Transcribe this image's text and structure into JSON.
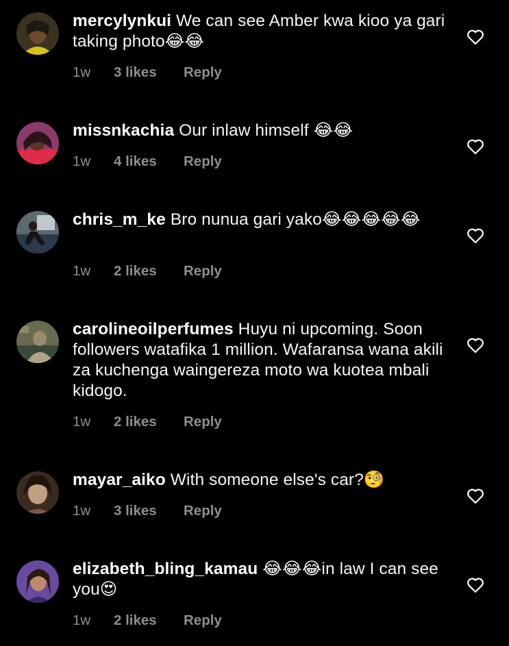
{
  "comments": [
    {
      "username": "mercylynkui",
      "text": "We can see Amber kwa kioo ya gari taking photo😂😂",
      "time": "1w",
      "likes": "3 likes",
      "reply": "Reply",
      "avatar_colors": [
        "#3a3320",
        "#d4c21a",
        "#5a4026"
      ]
    },
    {
      "username": "missnkachia",
      "text": "Our inlaw himself 😂😂",
      "time": "1w",
      "likes": "4 likes",
      "reply": "Reply",
      "avatar_colors": [
        "#8a3b6a",
        "#e02a4a",
        "#4a2030"
      ]
    },
    {
      "username": "chris_m_ke",
      "text": "Bro nunua gari yako😂😂😂😂😂",
      "time": "1w",
      "likes": "2 likes",
      "reply": "Reply",
      "avatar_colors": [
        "#5a6a70",
        "#2a3a4a",
        "#c0c8cc"
      ]
    },
    {
      "username": "carolineoilperfumes",
      "text": "Huyu ni upcoming. Soon followers watafika 1 million. Wafaransa wana akili za kuchenga waingereza moto wa kuotea mbali kidogo.",
      "time": "1w",
      "likes": "2 likes",
      "reply": "Reply",
      "avatar_colors": [
        "#6a6a50",
        "#9a8a70",
        "#3a4a3a"
      ]
    },
    {
      "username": "mayar_aiko",
      "text": "With someone else's car?🧐",
      "time": "1w",
      "likes": "3 likes",
      "reply": "Reply",
      "avatar_colors": [
        "#3a2a20",
        "#7a5a40",
        "#c0a080"
      ]
    },
    {
      "username": "elizabeth_bling_kamau",
      "text": "😂😂😂in law I can see you😍",
      "time": "1w",
      "likes": "2 likes",
      "reply": "Reply",
      "avatar_colors": [
        "#6a4aa0",
        "#c08a6a",
        "#3a2a6a"
      ]
    }
  ],
  "icons": {
    "like": "heart-outline-icon"
  },
  "colors": {
    "background": "#000000",
    "text": "#f5f5f5",
    "meta": "#8e8e8e"
  }
}
